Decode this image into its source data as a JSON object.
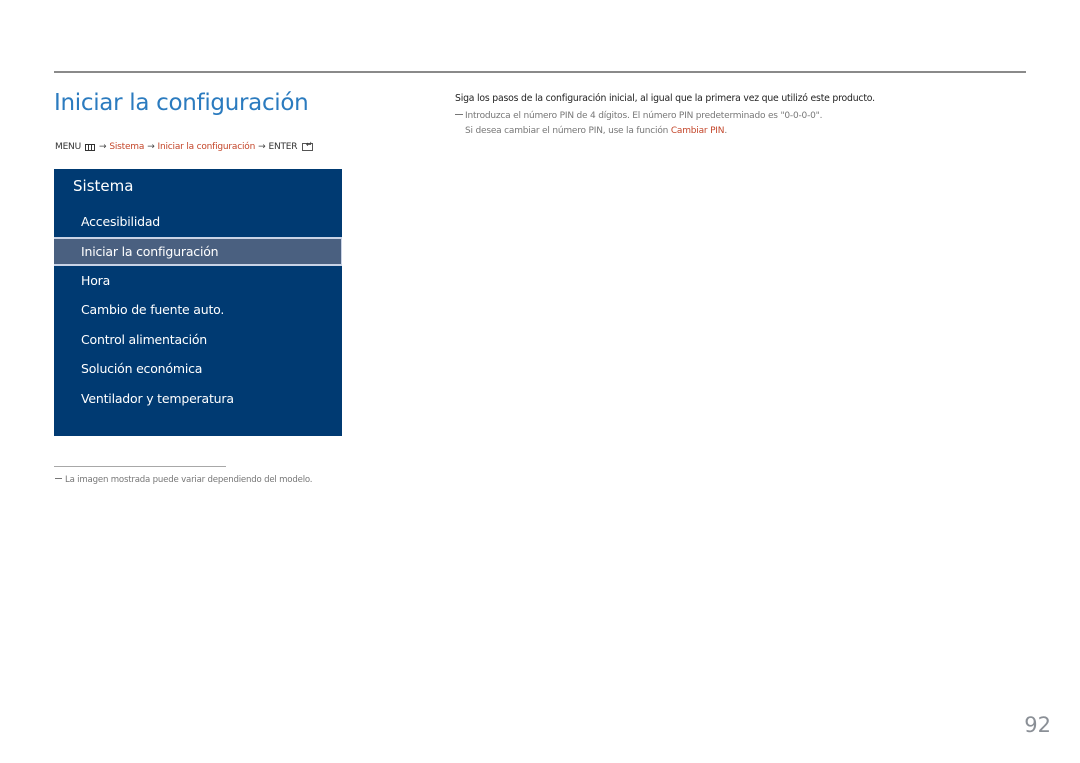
{
  "page": {
    "title": "Iniciar la configuración",
    "number": "92"
  },
  "breadcrumb": {
    "menu_label": "MENU",
    "menu_icon": "menu-icon",
    "arrow": "→",
    "items": [
      "Sistema",
      "Iniciar la configuración"
    ],
    "enter_label": "ENTER",
    "enter_icon": "enter-icon"
  },
  "osd_menu": {
    "title": "Sistema",
    "items": [
      {
        "label": "Accesibilidad",
        "selected": false
      },
      {
        "label": "Iniciar la configuración",
        "selected": true
      },
      {
        "label": "Hora",
        "selected": false
      },
      {
        "label": "Cambio de fuente auto.",
        "selected": false
      },
      {
        "label": "Control alimentación",
        "selected": false
      },
      {
        "label": "Solución económica",
        "selected": false
      },
      {
        "label": "Ventilador y temperatura",
        "selected": false
      }
    ],
    "colors": {
      "background": "#003a72",
      "selected_background": "#4a6080",
      "text": "#ffffff"
    }
  },
  "description": {
    "intro": "Siga los pasos de la configuración inicial, al igual que la primera vez que utilizó este producto.",
    "note_line1": "Introduzca el número PIN de 4 dígitos. El número PIN predeterminado es \"0-0-0-0\".",
    "note_line2_prefix": "Si desea cambiar el número PIN, use la función ",
    "note_line2_link": "Cambiar PIN",
    "note_line2_suffix": "."
  },
  "footnote": {
    "text": "La imagen mostrada puede variar dependiendo del modelo."
  },
  "colors": {
    "title": "#2b7bbf",
    "link": "#c4472b",
    "page_number": "#8a8f96"
  }
}
